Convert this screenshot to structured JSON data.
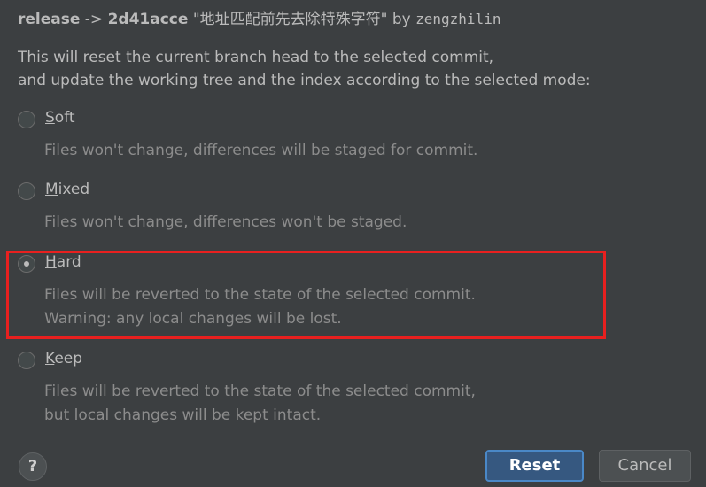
{
  "header": {
    "branch": "release",
    "arrow": "->",
    "commit_hash": "2d41acce",
    "commit_message": "\"地址匹配前先去除特殊字符\"",
    "by": "by",
    "author": "zengzhilin"
  },
  "description": {
    "line1": "This will reset the current branch head to the selected commit,",
    "line2": "and update the working tree and the index according to the selected mode:"
  },
  "options": [
    {
      "mnemonic": "S",
      "rest": "oft",
      "help1": "Files won't change, differences will be staged for commit.",
      "checked": false
    },
    {
      "mnemonic": "M",
      "rest": "ixed",
      "help1": "Files won't change, differences won't be staged.",
      "checked": false
    },
    {
      "mnemonic": "H",
      "rest": "ard",
      "help1": "Files will be reverted to the state of the selected commit.",
      "help2": "Warning: any local changes will be lost.",
      "checked": true
    },
    {
      "mnemonic": "K",
      "rest": "eep",
      "help1": "Files will be reverted to the state of the selected commit,",
      "help2": "but local changes will be kept intact.",
      "checked": false
    }
  ],
  "buttons": {
    "help": "?",
    "reset": "Reset",
    "cancel": "Cancel"
  },
  "colors": {
    "background": "#3c3f41",
    "highlight": "#e8201f",
    "primary_button": "#365880"
  }
}
